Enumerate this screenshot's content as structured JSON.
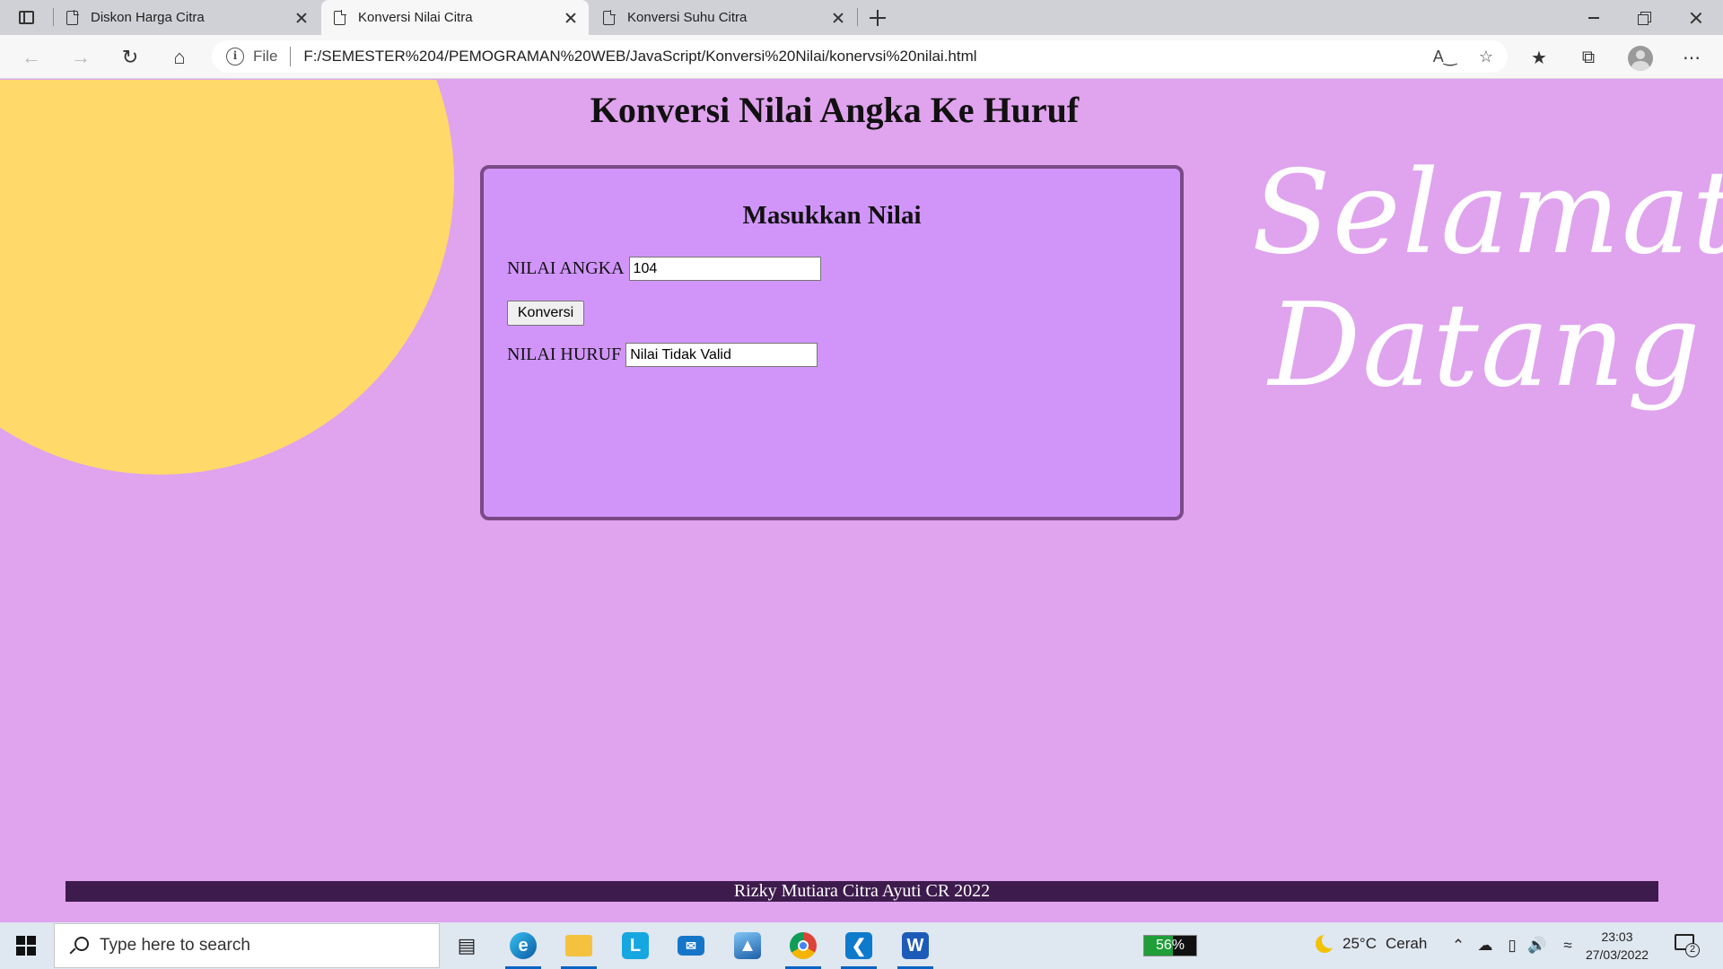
{
  "browser": {
    "tabs": [
      {
        "title": "Diskon Harga Citra",
        "active": false
      },
      {
        "title": "Konversi Nilai Citra",
        "active": true
      },
      {
        "title": "Konversi Suhu Citra",
        "active": false
      }
    ],
    "address": {
      "scheme_label": "File",
      "url": "F:/SEMESTER%204/PEMOGRAMAN%20WEB/JavaScript/Konversi%20Nilai/konervsi%20nilai.html"
    }
  },
  "page": {
    "title": "Konversi Nilai Angka Ke Huruf",
    "welcome_line1": "Selamat",
    "welcome_line2": "Datang",
    "form": {
      "heading": "Masukkan Nilai",
      "numeric_label": "NILAI ANGKA",
      "numeric_value": "104",
      "convert_button": "Konversi",
      "letter_label": "NILAI HURUF",
      "letter_value": "Nilai Tidak Valid"
    },
    "footer": "Rizky Mutiara Citra Ayuti CR 2022"
  },
  "colors": {
    "page_background": "#e0a3ee",
    "sun": "#ffd96a",
    "form_background": "#d195f9",
    "form_border": "#7a4a86",
    "footer_background": "#3e1b4d"
  },
  "taskbar": {
    "search_placeholder": "Type here to search",
    "battery_percent": 56,
    "battery_label": "56%",
    "weather_temp": "25°C",
    "weather_desc": "Cerah",
    "time": "23:03",
    "date": "27/03/2022",
    "notification_count": "2",
    "apps": [
      "task-view-icon",
      "edge-icon",
      "file-explorer-icon",
      "l-app-icon",
      "mail-icon",
      "photos-icon",
      "chrome-icon",
      "vscode-icon",
      "word-icon"
    ]
  }
}
